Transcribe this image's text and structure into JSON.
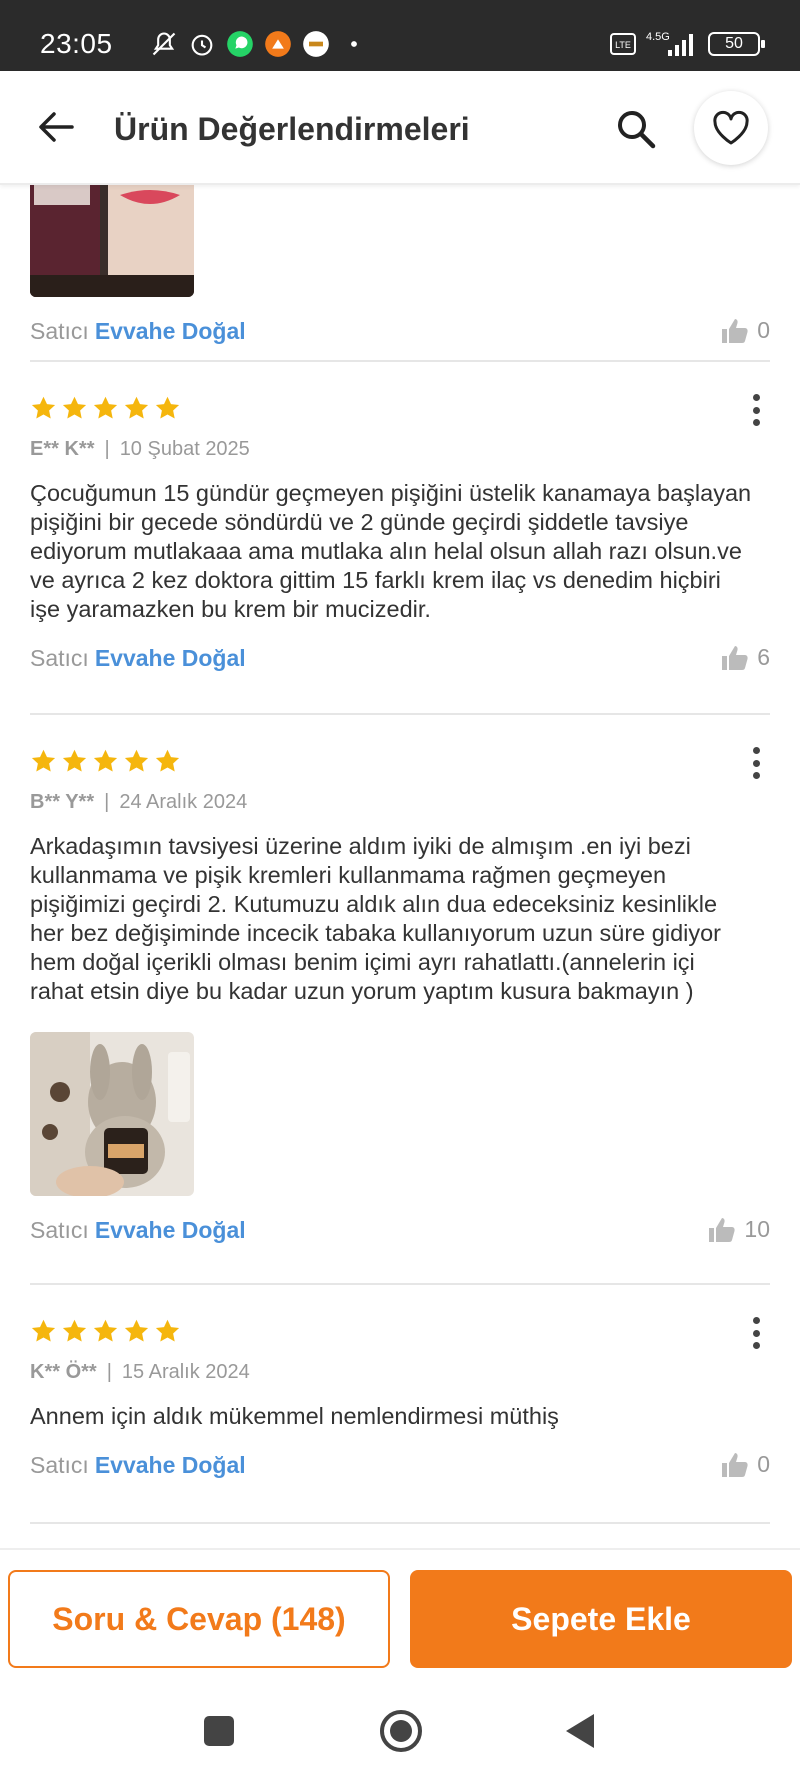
{
  "status_bar": {
    "time": "23:05",
    "network": "4.5G",
    "volte": "Vo LTE",
    "battery": "50"
  },
  "header": {
    "title": "Ürün Değerlendirmeleri"
  },
  "seller_label": "Satıcı",
  "reviews": [
    {
      "seller": "Evvahe Doğal",
      "likes": "0"
    },
    {
      "stars": 5,
      "author": "E** K**",
      "date": "10 Şubat 2025",
      "text": "Çocuğumun 15 gündür geçmeyen pişiğini üstelik kanamaya başlayan pişiğini bir gecede söndürdü ve 2 günde geçirdi şiddetle tavsiye ediyorum mutlakaaa ama mutlaka alın helal olsun allah razı olsun.ve ve ayrıca 2 kez doktora gittim 15 farklı krem ilaç vs denedim hiçbiri işe yaramazken bu krem bir mucizedir.",
      "seller": "Evvahe Doğal",
      "likes": "6"
    },
    {
      "stars": 5,
      "author": "B** Y**",
      "date": "24 Aralık 2024",
      "text": "Arkadaşımın tavsiyesi üzerine aldım iyiki de almışım .en iyi bezi kullanmama ve pişik kremleri kullanmama rağmen geçmeyen pişiğimizi geçirdi 2. Kutumuzu aldık alın dua edeceksiniz kesinlikle her bez değişiminde incecik tabaka kullanıyorum uzun süre gidiyor hem doğal içerikli olması benim içimi ayrı rahatlattı.(annelerin içi rahat etsin diye bu kadar uzun yorum yaptım kusura bakmayın )",
      "seller": "Evvahe Doğal",
      "likes": "10"
    },
    {
      "stars": 5,
      "author": "K** Ö**",
      "date": "15 Aralık 2024",
      "text": "Annem için aldık mükemmel nemlendirmesi müthiş",
      "seller": "Evvahe Doğal",
      "likes": "0"
    }
  ],
  "bottom": {
    "qa_label": "Soru & Cevap (148)",
    "cart_label": "Sepete Ekle"
  },
  "colors": {
    "accent": "#f27a1a",
    "seller_link": "#4a90d9",
    "star": "#f5b60d"
  }
}
